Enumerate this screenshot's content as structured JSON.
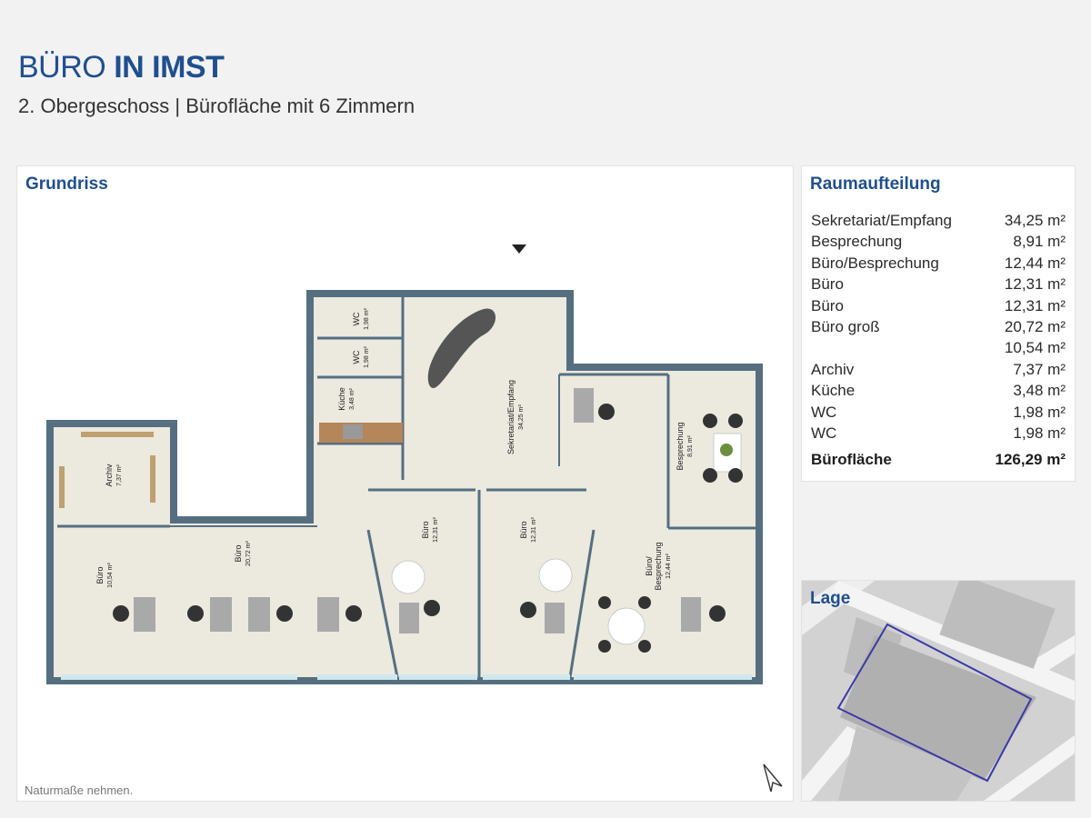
{
  "header": {
    "title_light": "BÜRO",
    "title_bold": "IN IMST",
    "subtitle": "2. Obergeschoss | Bürofläche mit 6 Zimmern"
  },
  "plan": {
    "heading": "Grundriss",
    "footnote": "Naturmaße nehmen.",
    "rooms": [
      {
        "name": "Sekretariat/Empfang",
        "area": "34,25 m²"
      },
      {
        "name": "Besprechung",
        "area": "8,91 m²"
      },
      {
        "name": "Büro/",
        "name2": "Besprechung",
        "area": "12,44 m²"
      },
      {
        "name": "Büro",
        "area": "12,31 m²"
      },
      {
        "name": "Büro",
        "area": "12,31 m²"
      },
      {
        "name": "Büro",
        "area": "20,72 m²"
      },
      {
        "name": "Büro",
        "area": "10,54 m²"
      },
      {
        "name": "Archiv",
        "area": "7,37 m²"
      },
      {
        "name": "Küche",
        "area": "3,48 m²"
      },
      {
        "name": "WC",
        "area": "1,98 m²"
      },
      {
        "name": "WC",
        "area": "1,98 m²"
      }
    ],
    "colors": {
      "wall": "#556f80",
      "floor": "#ece9df",
      "window": "#cfe8ee"
    }
  },
  "breakdown": {
    "heading": "Raumaufteilung",
    "rows": [
      {
        "label": "Sekretariat/Empfang",
        "value": "34,25 m²"
      },
      {
        "label": "Besprechung",
        "value": "8,91 m²"
      },
      {
        "label": "Büro/Besprechung",
        "value": "12,44 m²"
      },
      {
        "label": "Büro",
        "value": "12,31 m²"
      },
      {
        "label": "Büro",
        "value": "12,31 m²"
      },
      {
        "label": "Büro groß",
        "value": "20,72 m²"
      },
      {
        "label": "",
        "value": "10,54 m²"
      },
      {
        "label": "Archiv",
        "value": "7,37 m²"
      },
      {
        "label": "Küche",
        "value": "3,48 m²"
      },
      {
        "label": "WC",
        "value": "1,98 m²"
      },
      {
        "label": "WC",
        "value": "1,98 m²"
      }
    ],
    "total_label": "Bürofläche",
    "total_value": "126,29 m²"
  },
  "location": {
    "heading": "Lage",
    "outline_color": "#3a3aa8"
  }
}
